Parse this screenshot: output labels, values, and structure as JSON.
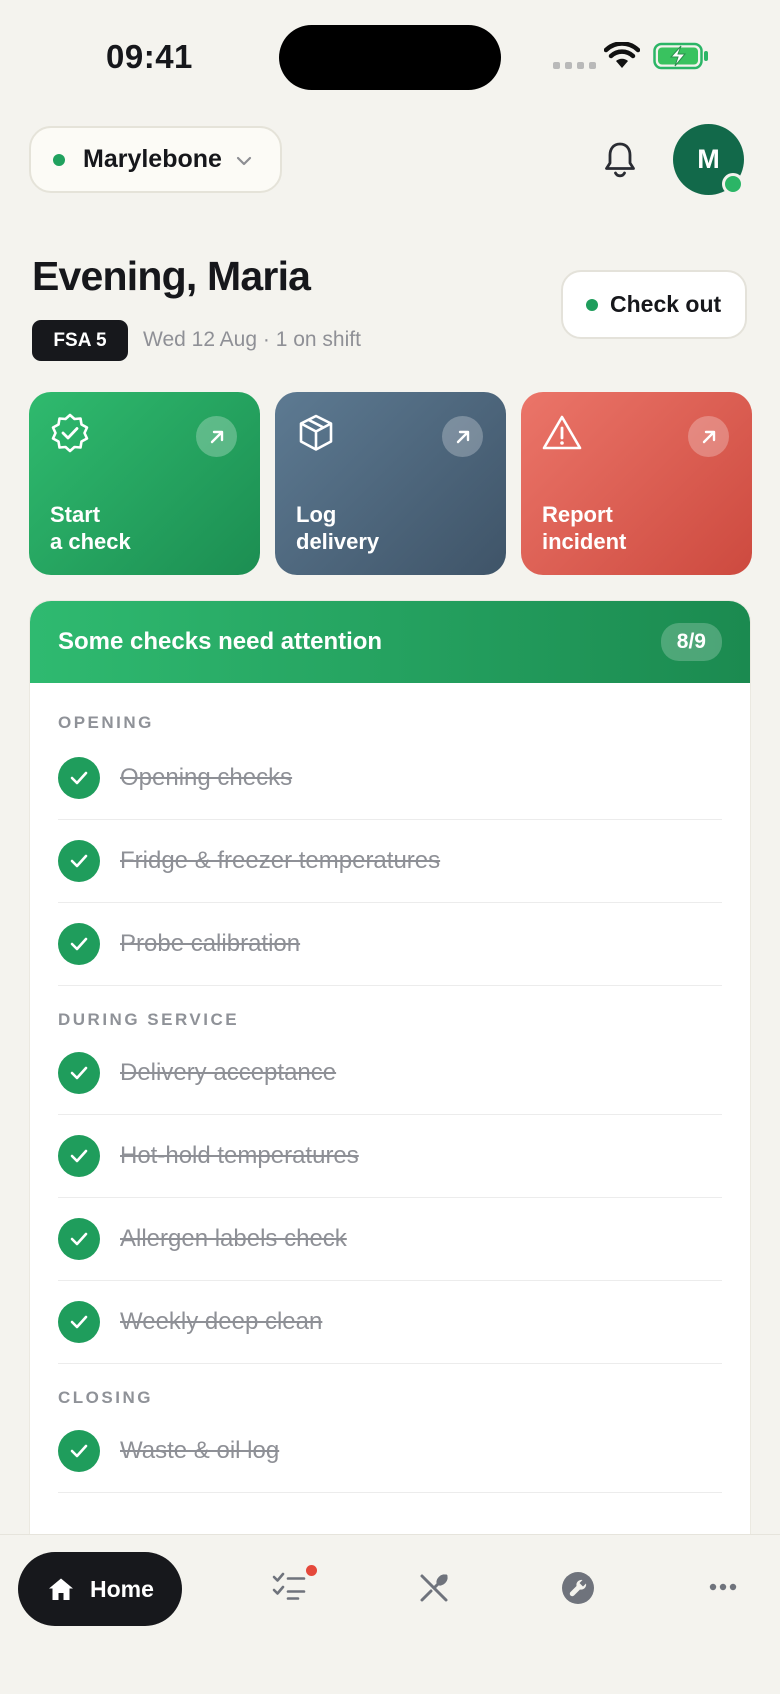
{
  "status_bar": {
    "time": "09:41"
  },
  "header": {
    "location": "Marylebone",
    "avatar_initial": "M"
  },
  "greeting": {
    "title": "Evening, Maria",
    "fsa_badge": "FSA 5",
    "meta": "Wed 12 Aug · 1 on shift",
    "checkout_label": "Check out"
  },
  "actions": [
    {
      "line1": "Start",
      "line2": "a check",
      "icon": "badge-check-icon"
    },
    {
      "line1": "Log",
      "line2": "delivery",
      "icon": "package-icon"
    },
    {
      "line1": "Report",
      "line2": "incident",
      "icon": "warning-icon"
    }
  ],
  "checks_panel": {
    "title": "Some checks need attention",
    "count": "8/9",
    "sections": [
      {
        "label": "OPENING",
        "items": [
          "Opening checks",
          "Fridge & freezer temperatures",
          "Probe calibration"
        ]
      },
      {
        "label": "DURING SERVICE",
        "items": [
          "Delivery acceptance",
          "Hot-hold temperatures",
          "Allergen labels check",
          "Weekly deep clean"
        ]
      },
      {
        "label": "CLOSING",
        "items": [
          "Waste & oil log"
        ]
      }
    ]
  },
  "nav": {
    "home_label": "Home"
  },
  "colors": {
    "accent_green": "#1f9d5c",
    "slate": "#4f667c",
    "alert_red": "#dd5d52",
    "ink": "#16171b",
    "background": "#f4f3ee"
  }
}
